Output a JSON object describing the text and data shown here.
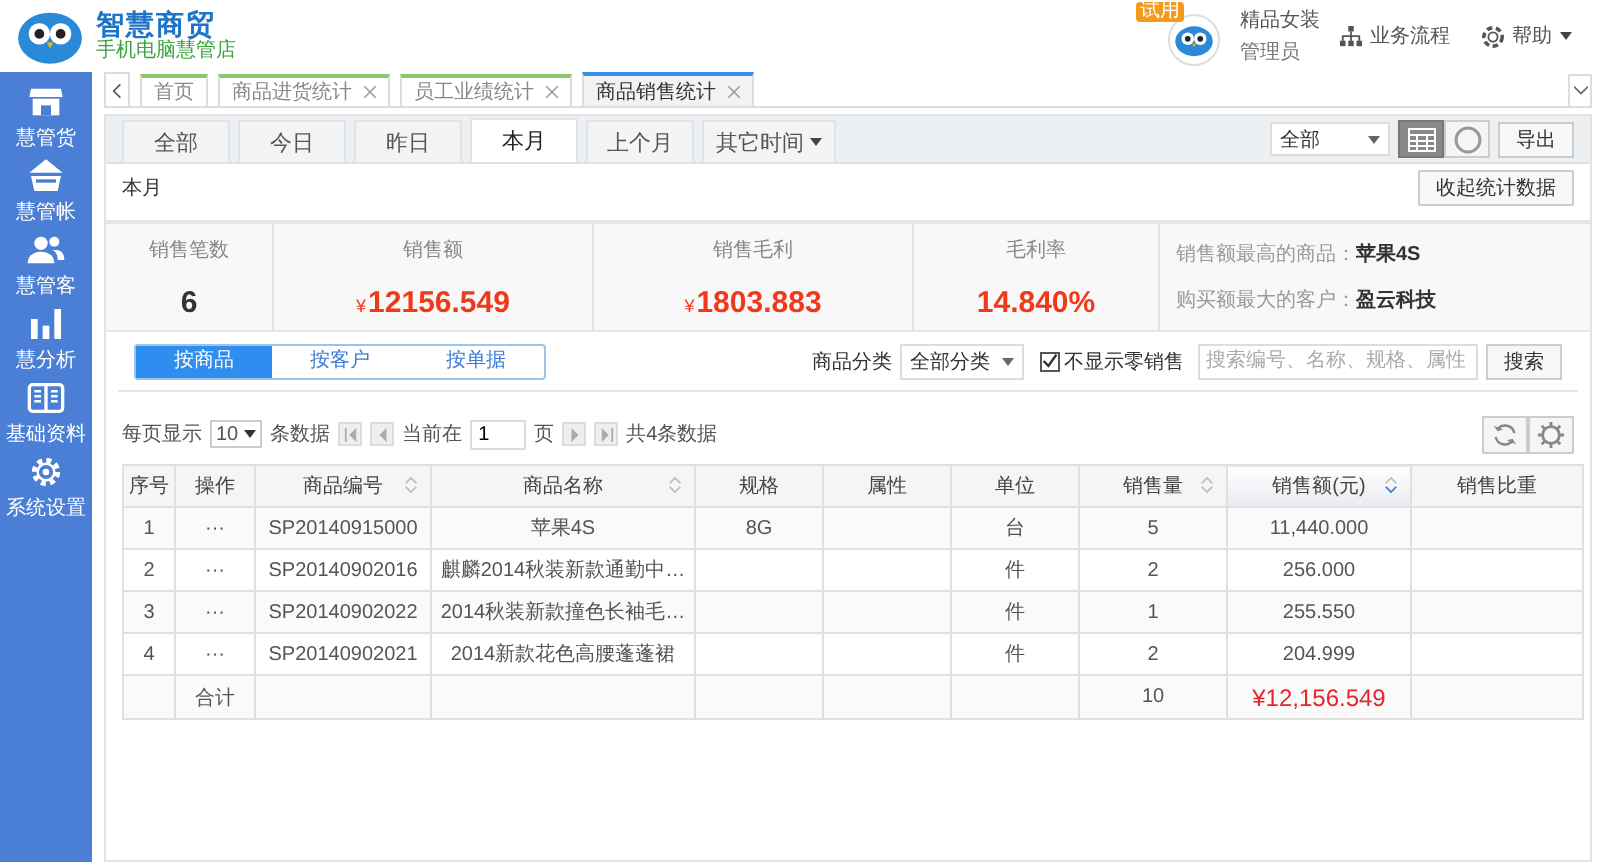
{
  "header": {
    "logo_title": "智慧商贸",
    "logo_subtitle": "手机电脑慧管店",
    "trial_badge": "试用",
    "shop_name": "精品女装",
    "role": "管理员",
    "links": [
      {
        "kind": "flow",
        "label": "业务流程"
      },
      {
        "kind": "help",
        "label": "帮助"
      }
    ]
  },
  "sidebar": {
    "items": [
      {
        "kind": "store",
        "label": "慧管货"
      },
      {
        "kind": "basket",
        "label": "慧管帐"
      },
      {
        "kind": "people",
        "label": "慧管客"
      },
      {
        "kind": "bars",
        "label": "慧分析"
      },
      {
        "kind": "book",
        "label": "基础资料"
      },
      {
        "kind": "gear",
        "label": "系统设置"
      }
    ]
  },
  "page_tabs": [
    {
      "label": "首页",
      "closable": false,
      "selected": false
    },
    {
      "label": "商品进货统计",
      "closable": true,
      "selected": false
    },
    {
      "label": "员工业绩统计",
      "closable": true,
      "selected": false
    },
    {
      "label": "商品销售统计",
      "closable": true,
      "selected": true
    }
  ],
  "period_tabs": [
    {
      "label": "全部",
      "dropdown": false,
      "selected": false
    },
    {
      "label": "今日",
      "dropdown": false,
      "selected": false
    },
    {
      "label": "昨日",
      "dropdown": false,
      "selected": false
    },
    {
      "label": "本月",
      "dropdown": false,
      "selected": true
    },
    {
      "label": "上个月",
      "dropdown": false,
      "selected": false
    },
    {
      "label": "其它时间",
      "dropdown": true,
      "selected": false
    }
  ],
  "toolbar": {
    "scope_select": "全部",
    "views": [
      {
        "kind": "calendar",
        "selected": true
      },
      {
        "kind": "circle",
        "selected": false
      }
    ],
    "export_button": "导出"
  },
  "period_label": "本月",
  "collapse_button": "收起统计数据",
  "stats": [
    {
      "kind": "count",
      "label": "销售笔数",
      "value": "6"
    },
    {
      "kind": "money",
      "label": "销售额",
      "currency": "¥",
      "value": "12156.549"
    },
    {
      "kind": "money",
      "label": "销售毛利",
      "currency": "¥",
      "value": "1803.883"
    },
    {
      "kind": "rate",
      "label": "毛利率",
      "value": "14.840%"
    }
  ],
  "highlights": [
    {
      "label": "销售额最高的商品：",
      "value": "苹果4S"
    },
    {
      "label": "购买额最大的客户：",
      "value": "盈云科技"
    }
  ],
  "group_tabs": [
    {
      "label": "按商品",
      "selected": true
    },
    {
      "label": "按客户",
      "selected": false
    },
    {
      "label": "按单据",
      "selected": false
    }
  ],
  "filters": {
    "category_label": "商品分类",
    "category_value": "全部分类",
    "hide_zero": {
      "label": "不显示零销售",
      "checked": true
    },
    "search_placeholder": "搜索编号、名称、规格、属性",
    "search_button": "搜索"
  },
  "pager": {
    "per_page_label": "每页显示",
    "per_page": "10",
    "per_page_suffix": "条数据",
    "current_label": "当前在",
    "current_page": "1",
    "page_suffix": "页",
    "total": "共4条数据"
  },
  "table": {
    "columns": [
      {
        "label": "序号",
        "sortable": false,
        "sorted": false
      },
      {
        "label": "操作",
        "sortable": false,
        "sorted": false
      },
      {
        "label": "商品编号",
        "sortable": true,
        "sorted": false
      },
      {
        "label": "商品名称",
        "sortable": true,
        "sorted": false
      },
      {
        "label": "规格",
        "sortable": false,
        "sorted": false
      },
      {
        "label": "属性",
        "sortable": false,
        "sorted": false
      },
      {
        "label": "单位",
        "sortable": false,
        "sorted": false
      },
      {
        "label": "销售量",
        "sortable": true,
        "sorted": false
      },
      {
        "label": "销售额(元)",
        "sortable": true,
        "sorted": true
      },
      {
        "label": "销售比重",
        "sortable": false,
        "sorted": false
      }
    ],
    "rows": [
      {
        "no": "1",
        "action": "···",
        "code": "SP20140915000",
        "name": "苹果4S",
        "spec": "8G",
        "unit": "台",
        "qty": "5",
        "amount": "11,440.000"
      },
      {
        "no": "2",
        "action": "···",
        "code": "SP20140902016",
        "name": "麒麟2014秋装新款通勤中…",
        "unit": "件",
        "qty": "2",
        "amount": "256.000"
      },
      {
        "no": "3",
        "action": "···",
        "code": "SP20140902022",
        "name": "2014秋装新款撞色长袖毛…",
        "unit": "件",
        "qty": "1",
        "amount": "255.550"
      },
      {
        "no": "4",
        "action": "···",
        "code": "SP20140902021",
        "name": "2014新款花色高腰蓬蓬裙",
        "unit": "件",
        "qty": "2",
        "amount": "204.999"
      }
    ],
    "total_row": {
      "action": "合计",
      "qty": "10",
      "amount": "¥12,156.549"
    }
  }
}
